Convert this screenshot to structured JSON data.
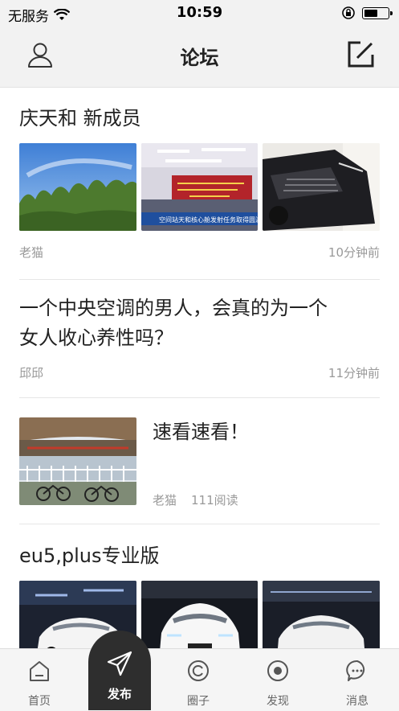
{
  "status_bar": {
    "carrier": "无服务",
    "time": "10:59",
    "battery_level": 0.6
  },
  "nav": {
    "title": "论坛",
    "left_icon": "user-icon",
    "right_icon": "edit-icon"
  },
  "posts": [
    {
      "title": "庆天和 新成员",
      "author": "老猫",
      "time": "10分钟前",
      "images": [
        "trees-sky-photo",
        "conference-hall-photo",
        "car-front-photo"
      ],
      "image_caption": "空间站天和核心舱发射任务取得圆满"
    },
    {
      "title_line1": "一个中央空调的男人，会真的为一个",
      "title_line2": "女人收心养性吗？",
      "author": "邱邱",
      "time": "11分钟前"
    },
    {
      "title": "速看速看！",
      "author": "老猫",
      "reads": "111阅读",
      "images": [
        "street-bicycles-photo"
      ]
    },
    {
      "title": "eu5,plus专业版",
      "images": [
        "car-show-photo-1",
        "car-show-photo-2",
        "car-show-photo-3"
      ]
    }
  ],
  "tabs": [
    {
      "label": "首页",
      "icon": "home-icon"
    },
    {
      "label": "发布",
      "icon": "send-icon"
    },
    {
      "label": "圈子",
      "icon": "circle-icon"
    },
    {
      "label": "发现",
      "icon": "discover-icon"
    },
    {
      "label": "消息",
      "icon": "message-icon"
    }
  ],
  "colors": {
    "bar_bg": "#f2f2f2",
    "publish_bg": "#2e2e2e",
    "meta_text": "#999999",
    "divider": "#e6e6e6"
  }
}
